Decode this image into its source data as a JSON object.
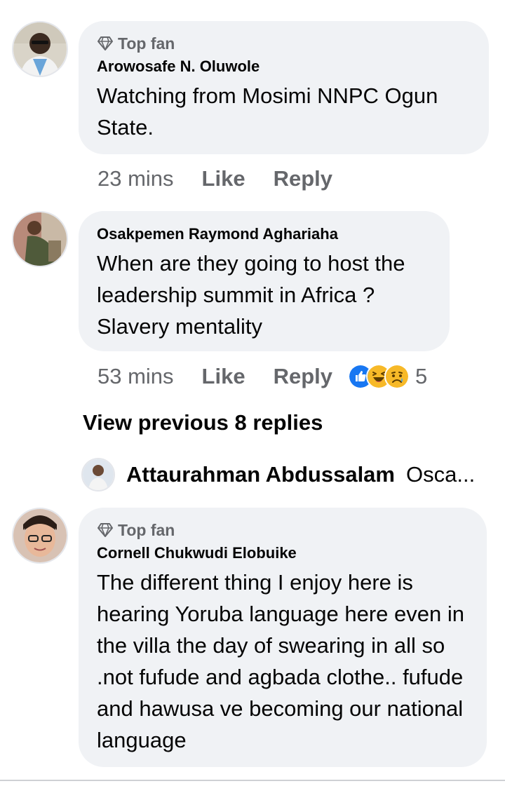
{
  "comments": [
    {
      "badge": "Top fan",
      "author": "Arowosafe N. Oluwole",
      "text": "Watching from Mosimi NNPC Ogun State.",
      "time": "23 mins",
      "like": "Like",
      "reply": "Reply"
    },
    {
      "author": "Osakpemen Raymond Aghariaha",
      "text": "When are they going to host the leadership summit in Africa ? Slavery mentality",
      "time": "53 mins",
      "like": "Like",
      "reply": "Reply",
      "reaction_count": "5",
      "reactions": [
        "like-reaction-icon",
        "haha-reaction-icon",
        "sad-reaction-icon"
      ]
    },
    {
      "badge": "Top fan",
      "author": "Cornell Chukwudi Elobuike",
      "text": "The different thing I enjoy here is hearing Yoruba language here even in the villa the day of swearing in all so .not fufude and agbada clothe.. fufude and hawusa ve becoming our national language"
    }
  ],
  "view_previous": "View previous 8 replies",
  "latest_reply": {
    "author": "Attaurahman Abdussalam",
    "preview": "Osca..."
  },
  "colors": {
    "bubble": "#f0f2f5",
    "meta_text": "#65676b",
    "text": "#050505",
    "like_blue": "#1877f2",
    "emoji_yellow": "#f7b928"
  }
}
